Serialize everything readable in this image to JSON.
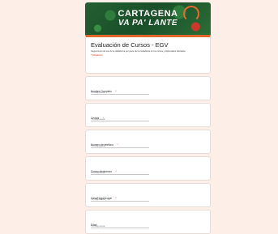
{
  "banner": {
    "line1": "CARTAGENA",
    "line2": "VA PA' LANTE"
  },
  "form": {
    "title": "Evaluación de Cursos - EGV",
    "description": "Seguimiento de uso de la plataforma por parte de la ciudadanía en los cursos y diplomados ofertados.",
    "required_note": "* Obligatorio"
  },
  "questions": [
    {
      "label": "Nombre Completo",
      "required": "*",
      "placeholder": "Tu respuesta"
    },
    {
      "label": "Cédula",
      "required": "*",
      "placeholder": "Tu respuesta"
    },
    {
      "label": "Número de teléfono",
      "required": "*",
      "placeholder": "Tu respuesta"
    },
    {
      "label": "Correo electrónico",
      "required": "*",
      "placeholder": "Tu respuesta"
    },
    {
      "label": "Casa/Hogar/Lugar",
      "required": "*",
      "placeholder": "Tu respuesta"
    },
    {
      "label": "Edad",
      "required": "",
      "placeholder": "Tu respuesta"
    }
  ],
  "colors": {
    "page_bg": "#fdeee7",
    "accent": "#e1672d",
    "banner_green": "#1d5a2e",
    "required_red": "#d93025"
  }
}
